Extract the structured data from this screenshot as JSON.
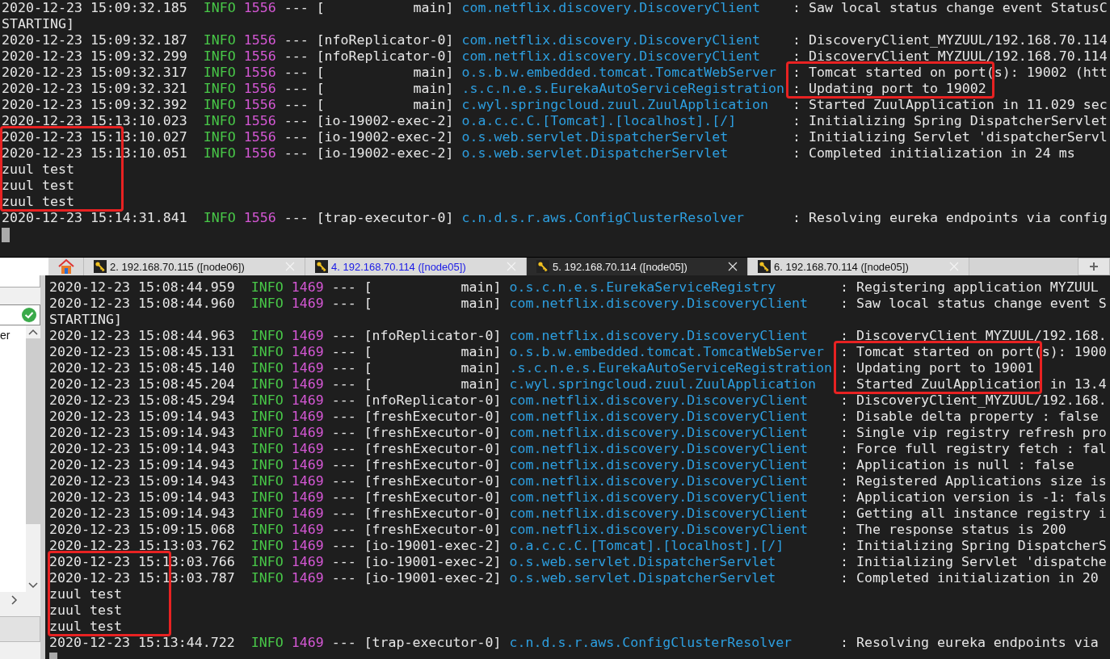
{
  "top_terminal": {
    "lines": [
      {
        "kind": "log",
        "time": "2020-12-23 15:09:32.185",
        "level": "INFO",
        "pid": "1556",
        "sep": "---",
        "thread": "[           main]",
        "logger": "com.netflix.discovery.DiscoveryClient",
        "message": ": Saw local status change event StatusC"
      },
      {
        "kind": "plain",
        "text": "STARTING]"
      },
      {
        "kind": "log",
        "time": "2020-12-23 15:09:32.187",
        "level": "INFO",
        "pid": "1556",
        "sep": "---",
        "thread": "[nfoReplicator-0]",
        "logger": "com.netflix.discovery.DiscoveryClient",
        "message": ": DiscoveryClient_MYZUUL/192.168.70.114"
      },
      {
        "kind": "log",
        "time": "2020-12-23 15:09:32.299",
        "level": "INFO",
        "pid": "1556",
        "sep": "---",
        "thread": "[nfoReplicator-0]",
        "logger": "com.netflix.discovery.DiscoveryClient",
        "message": ": DiscoveryClient_MYZUUL/192.168.70.114"
      },
      {
        "kind": "log",
        "time": "2020-12-23 15:09:32.317",
        "level": "INFO",
        "pid": "1556",
        "sep": "---",
        "thread": "[           main]",
        "logger": "o.s.b.w.embedded.tomcat.TomcatWebServer",
        "message": ": Tomcat started on port(s): 19002 (htt",
        "message_boxed": true
      },
      {
        "kind": "log",
        "time": "2020-12-23 15:09:32.321",
        "level": "INFO",
        "pid": "1556",
        "sep": "---",
        "thread": "[           main]",
        "logger": ".s.c.n.e.s.EurekaAutoServiceRegistration",
        "message": ": Updating port to 19002",
        "message_boxed": true
      },
      {
        "kind": "log",
        "time": "2020-12-23 15:09:32.392",
        "level": "INFO",
        "pid": "1556",
        "sep": "---",
        "thread": "[           main]",
        "logger": "c.wyl.springcloud.zuul.ZuulApplication",
        "message": ": Started ZuulApplication in 11.029 sec"
      },
      {
        "kind": "log",
        "time": "2020-12-23 15:13:10.023",
        "level": "INFO",
        "pid": "1556",
        "sep": "---",
        "thread": "[io-19002-exec-2]",
        "logger": "o.a.c.c.C.[Tomcat].[localhost].[/]",
        "message": ": Initializing Spring DispatcherServlet"
      },
      {
        "kind": "log",
        "time": "2020-12-23 15:13:10.027",
        "level": "INFO",
        "pid": "1556",
        "sep": "---",
        "thread": "[io-19002-exec-2]",
        "logger": "o.s.web.servlet.DispatcherServlet",
        "message": ": Initializing Servlet 'dispatcherServl",
        "time_boxed": true
      },
      {
        "kind": "log",
        "time": "2020-12-23 15:13:10.051",
        "level": "INFO",
        "pid": "1556",
        "sep": "---",
        "thread": "[io-19002-exec-2]",
        "logger": "o.s.web.servlet.DispatcherServlet",
        "message": ": Completed initialization in 24 ms",
        "time_boxed": true
      },
      {
        "kind": "plain",
        "text": "zuul test",
        "time_boxed": true
      },
      {
        "kind": "plain",
        "text": "zuul test",
        "time_boxed": true
      },
      {
        "kind": "plain",
        "text": "zuul test",
        "time_boxed": true
      },
      {
        "kind": "log",
        "time": "2020-12-23 15:14:31.841",
        "level": "INFO",
        "pid": "1556",
        "sep": "---",
        "thread": "[trap-executor-0]",
        "logger": "c.n.d.s.r.aws.ConfigClusterResolver",
        "message": ": Resolving eureka endpoints via config"
      },
      {
        "kind": "cursor"
      }
    ]
  },
  "tabs": [
    {
      "kind": "home",
      "selected": false
    },
    {
      "kind": "session",
      "label": "2. 192.168.70.115 ([node06])",
      "selected": false,
      "activity": false
    },
    {
      "kind": "session",
      "label": "4. 192.168.70.114 ([node05])",
      "selected": false,
      "activity": true
    },
    {
      "kind": "session",
      "label": "5. 192.168.70.114 ([node05])",
      "selected": true,
      "activity": false
    },
    {
      "kind": "session",
      "label": "6. 192.168.70.114 ([node05])",
      "selected": false,
      "activity": false
    }
  ],
  "side_panel": {
    "list_items": [
      "er"
    ]
  },
  "bottom_terminal": {
    "lines": [
      {
        "kind": "log",
        "time": "2020-12-23 15:08:44.959",
        "level": "INFO",
        "pid": "1469",
        "sep": "---",
        "thread": "[           main]",
        "logger": "o.s.c.n.e.s.EurekaServiceRegistry",
        "message": ": Registering application MYZUUL"
      },
      {
        "kind": "log",
        "time": "2020-12-23 15:08:44.960",
        "level": "INFO",
        "pid": "1469",
        "sep": "---",
        "thread": "[           main]",
        "logger": "com.netflix.discovery.DiscoveryClient",
        "message": ": Saw local status change event S"
      },
      {
        "kind": "plain",
        "text": "STARTING]"
      },
      {
        "kind": "log",
        "time": "2020-12-23 15:08:44.963",
        "level": "INFO",
        "pid": "1469",
        "sep": "---",
        "thread": "[nfoReplicator-0]",
        "logger": "com.netflix.discovery.DiscoveryClient",
        "message": ": DiscoveryClient_MYZUUL/192.168."
      },
      {
        "kind": "log",
        "time": "2020-12-23 15:08:45.131",
        "level": "INFO",
        "pid": "1469",
        "sep": "---",
        "thread": "[           main]",
        "logger": "o.s.b.w.embedded.tomcat.TomcatWebServer",
        "message": ": Tomcat started on port(s): 1900",
        "message_boxed": true
      },
      {
        "kind": "log",
        "time": "2020-12-23 15:08:45.140",
        "level": "INFO",
        "pid": "1469",
        "sep": "---",
        "thread": "[           main]",
        "logger": ".s.c.n.e.s.EurekaAutoServiceRegistration",
        "message": ": Updating port to 19001",
        "message_boxed": true
      },
      {
        "kind": "log",
        "time": "2020-12-23 15:08:45.204",
        "level": "INFO",
        "pid": "1469",
        "sep": "---",
        "thread": "[           main]",
        "logger": "c.wyl.springcloud.zuul.ZuulApplication",
        "message": ": Started ZuulApplication in 13.4",
        "message_boxed": true
      },
      {
        "kind": "log",
        "time": "2020-12-23 15:08:45.294",
        "level": "INFO",
        "pid": "1469",
        "sep": "---",
        "thread": "[nfoReplicator-0]",
        "logger": "com.netflix.discovery.DiscoveryClient",
        "message": ": DiscoveryClient_MYZUUL/192.168."
      },
      {
        "kind": "log",
        "time": "2020-12-23 15:09:14.943",
        "level": "INFO",
        "pid": "1469",
        "sep": "---",
        "thread": "[freshExecutor-0]",
        "logger": "com.netflix.discovery.DiscoveryClient",
        "message": ": Disable delta property : false"
      },
      {
        "kind": "log",
        "time": "2020-12-23 15:09:14.943",
        "level": "INFO",
        "pid": "1469",
        "sep": "---",
        "thread": "[freshExecutor-0]",
        "logger": "com.netflix.discovery.DiscoveryClient",
        "message": ": Single vip registry refresh pro"
      },
      {
        "kind": "log",
        "time": "2020-12-23 15:09:14.943",
        "level": "INFO",
        "pid": "1469",
        "sep": "---",
        "thread": "[freshExecutor-0]",
        "logger": "com.netflix.discovery.DiscoveryClient",
        "message": ": Force full registry fetch : fal"
      },
      {
        "kind": "log",
        "time": "2020-12-23 15:09:14.943",
        "level": "INFO",
        "pid": "1469",
        "sep": "---",
        "thread": "[freshExecutor-0]",
        "logger": "com.netflix.discovery.DiscoveryClient",
        "message": ": Application is null : false"
      },
      {
        "kind": "log",
        "time": "2020-12-23 15:09:14.943",
        "level": "INFO",
        "pid": "1469",
        "sep": "---",
        "thread": "[freshExecutor-0]",
        "logger": "com.netflix.discovery.DiscoveryClient",
        "message": ": Registered Applications size is"
      },
      {
        "kind": "log",
        "time": "2020-12-23 15:09:14.943",
        "level": "INFO",
        "pid": "1469",
        "sep": "---",
        "thread": "[freshExecutor-0]",
        "logger": "com.netflix.discovery.DiscoveryClient",
        "message": ": Application version is -1: fals"
      },
      {
        "kind": "log",
        "time": "2020-12-23 15:09:14.943",
        "level": "INFO",
        "pid": "1469",
        "sep": "---",
        "thread": "[freshExecutor-0]",
        "logger": "com.netflix.discovery.DiscoveryClient",
        "message": ": Getting all instance registry i"
      },
      {
        "kind": "log",
        "time": "2020-12-23 15:09:15.068",
        "level": "INFO",
        "pid": "1469",
        "sep": "---",
        "thread": "[freshExecutor-0]",
        "logger": "com.netflix.discovery.DiscoveryClient",
        "message": ": The response status is 200"
      },
      {
        "kind": "log",
        "time": "2020-12-23 15:13:03.762",
        "level": "INFO",
        "pid": "1469",
        "sep": "---",
        "thread": "[io-19001-exec-2]",
        "logger": "o.a.c.c.C.[Tomcat].[localhost].[/]",
        "message": ": Initializing Spring DispatcherS"
      },
      {
        "kind": "log",
        "time": "2020-12-23 15:13:03.766",
        "level": "INFO",
        "pid": "1469",
        "sep": "---",
        "thread": "[io-19001-exec-2]",
        "logger": "o.s.web.servlet.DispatcherServlet",
        "message": ": Initializing Servlet 'dispatche",
        "time_boxed": true
      },
      {
        "kind": "log",
        "time": "2020-12-23 15:13:03.787",
        "level": "INFO",
        "pid": "1469",
        "sep": "---",
        "thread": "[io-19001-exec-2]",
        "logger": "o.s.web.servlet.DispatcherServlet",
        "message": ": Completed initialization in 20",
        "time_boxed": true
      },
      {
        "kind": "plain",
        "text": "zuul test",
        "time_boxed": true
      },
      {
        "kind": "plain",
        "text": "zuul test",
        "time_boxed": true
      },
      {
        "kind": "plain",
        "text": "zuul test",
        "time_boxed": true
      },
      {
        "kind": "log",
        "time": "2020-12-23 15:13:44.722",
        "level": "INFO",
        "pid": "1469",
        "sep": "---",
        "thread": "[trap-executor-0]",
        "logger": "c.n.d.s.r.aws.ConfigClusterResolver",
        "message": ": Resolving eureka endpoints via"
      },
      {
        "kind": "cursor"
      }
    ]
  }
}
